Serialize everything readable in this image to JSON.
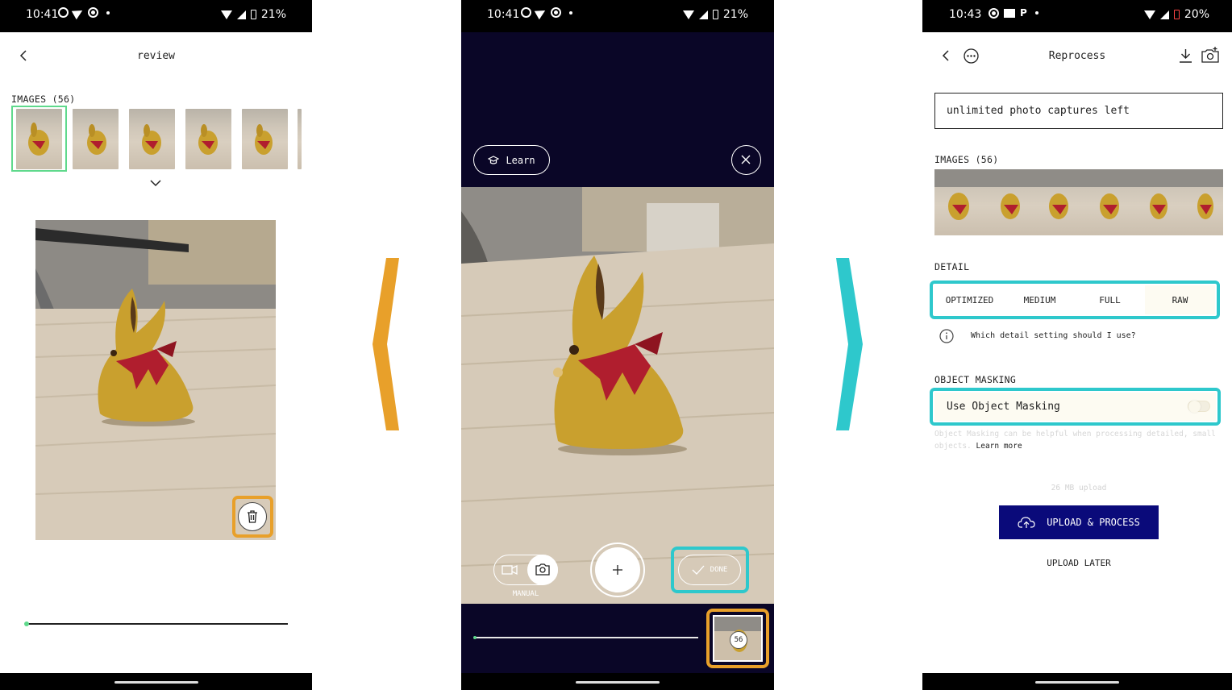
{
  "colors": {
    "accent_orange": "#E8A02A",
    "accent_teal": "#2EC8CC",
    "thumb_selected": "#5FD98C",
    "camera_bg": "#0A0627",
    "upload_button": "#0A0A7A"
  },
  "screen1": {
    "status": {
      "time": "10:41",
      "battery": "21%"
    },
    "title": "review",
    "images_label": "IMAGES (56)",
    "icons": [
      "back-arrow-icon",
      "chevron-down-icon",
      "trash-icon"
    ]
  },
  "screen2": {
    "status": {
      "time": "10:41",
      "battery": "21%"
    },
    "learn_label": "Learn",
    "manual_label": "MANUAL",
    "done_label": "DONE",
    "capture_count": "56",
    "icons": [
      "graduation-cap-icon",
      "close-icon",
      "video-icon",
      "camera-icon",
      "plus-icon",
      "check-icon"
    ]
  },
  "screen3": {
    "status": {
      "time": "10:43",
      "battery": "20%"
    },
    "title": "Reprocess",
    "banner": "unlimited photo captures left",
    "images_label": "IMAGES (56)",
    "detail_label": "DETAIL",
    "detail_options": [
      "OPTIMIZED",
      "MEDIUM",
      "FULL",
      "RAW"
    ],
    "detail_help": "Which detail setting should I use?",
    "masking_label": "OBJECT MASKING",
    "masking_toggle_label": "Use Object Masking",
    "masking_enabled": false,
    "masking_desc": "Object Masking can be helpful when processing detailed, small objects.",
    "learn_more": "Learn more",
    "upload_size": "26 MB upload",
    "upload_button": "UPLOAD & PROCESS",
    "upload_later": "UPLOAD LATER",
    "icons": [
      "back-arrow-icon",
      "more-icon",
      "download-icon",
      "camera-add-icon",
      "info-icon",
      "cloud-upload-icon"
    ]
  }
}
